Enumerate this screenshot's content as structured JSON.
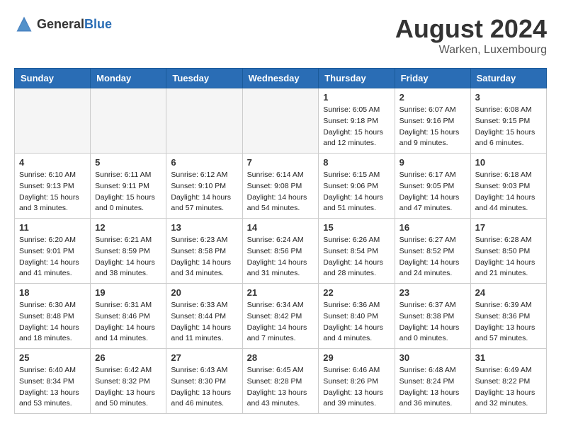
{
  "header": {
    "logo_general": "General",
    "logo_blue": "Blue",
    "month_year": "August 2024",
    "location": "Warken, Luxembourg"
  },
  "weekdays": [
    "Sunday",
    "Monday",
    "Tuesday",
    "Wednesday",
    "Thursday",
    "Friday",
    "Saturday"
  ],
  "weeks": [
    [
      {
        "day": "",
        "info": ""
      },
      {
        "day": "",
        "info": ""
      },
      {
        "day": "",
        "info": ""
      },
      {
        "day": "",
        "info": ""
      },
      {
        "day": "1",
        "info": "Sunrise: 6:05 AM\nSunset: 9:18 PM\nDaylight: 15 hours\nand 12 minutes."
      },
      {
        "day": "2",
        "info": "Sunrise: 6:07 AM\nSunset: 9:16 PM\nDaylight: 15 hours\nand 9 minutes."
      },
      {
        "day": "3",
        "info": "Sunrise: 6:08 AM\nSunset: 9:15 PM\nDaylight: 15 hours\nand 6 minutes."
      }
    ],
    [
      {
        "day": "4",
        "info": "Sunrise: 6:10 AM\nSunset: 9:13 PM\nDaylight: 15 hours\nand 3 minutes."
      },
      {
        "day": "5",
        "info": "Sunrise: 6:11 AM\nSunset: 9:11 PM\nDaylight: 15 hours\nand 0 minutes."
      },
      {
        "day": "6",
        "info": "Sunrise: 6:12 AM\nSunset: 9:10 PM\nDaylight: 14 hours\nand 57 minutes."
      },
      {
        "day": "7",
        "info": "Sunrise: 6:14 AM\nSunset: 9:08 PM\nDaylight: 14 hours\nand 54 minutes."
      },
      {
        "day": "8",
        "info": "Sunrise: 6:15 AM\nSunset: 9:06 PM\nDaylight: 14 hours\nand 51 minutes."
      },
      {
        "day": "9",
        "info": "Sunrise: 6:17 AM\nSunset: 9:05 PM\nDaylight: 14 hours\nand 47 minutes."
      },
      {
        "day": "10",
        "info": "Sunrise: 6:18 AM\nSunset: 9:03 PM\nDaylight: 14 hours\nand 44 minutes."
      }
    ],
    [
      {
        "day": "11",
        "info": "Sunrise: 6:20 AM\nSunset: 9:01 PM\nDaylight: 14 hours\nand 41 minutes."
      },
      {
        "day": "12",
        "info": "Sunrise: 6:21 AM\nSunset: 8:59 PM\nDaylight: 14 hours\nand 38 minutes."
      },
      {
        "day": "13",
        "info": "Sunrise: 6:23 AM\nSunset: 8:58 PM\nDaylight: 14 hours\nand 34 minutes."
      },
      {
        "day": "14",
        "info": "Sunrise: 6:24 AM\nSunset: 8:56 PM\nDaylight: 14 hours\nand 31 minutes."
      },
      {
        "day": "15",
        "info": "Sunrise: 6:26 AM\nSunset: 8:54 PM\nDaylight: 14 hours\nand 28 minutes."
      },
      {
        "day": "16",
        "info": "Sunrise: 6:27 AM\nSunset: 8:52 PM\nDaylight: 14 hours\nand 24 minutes."
      },
      {
        "day": "17",
        "info": "Sunrise: 6:28 AM\nSunset: 8:50 PM\nDaylight: 14 hours\nand 21 minutes."
      }
    ],
    [
      {
        "day": "18",
        "info": "Sunrise: 6:30 AM\nSunset: 8:48 PM\nDaylight: 14 hours\nand 18 minutes."
      },
      {
        "day": "19",
        "info": "Sunrise: 6:31 AM\nSunset: 8:46 PM\nDaylight: 14 hours\nand 14 minutes."
      },
      {
        "day": "20",
        "info": "Sunrise: 6:33 AM\nSunset: 8:44 PM\nDaylight: 14 hours\nand 11 minutes."
      },
      {
        "day": "21",
        "info": "Sunrise: 6:34 AM\nSunset: 8:42 PM\nDaylight: 14 hours\nand 7 minutes."
      },
      {
        "day": "22",
        "info": "Sunrise: 6:36 AM\nSunset: 8:40 PM\nDaylight: 14 hours\nand 4 minutes."
      },
      {
        "day": "23",
        "info": "Sunrise: 6:37 AM\nSunset: 8:38 PM\nDaylight: 14 hours\nand 0 minutes."
      },
      {
        "day": "24",
        "info": "Sunrise: 6:39 AM\nSunset: 8:36 PM\nDaylight: 13 hours\nand 57 minutes."
      }
    ],
    [
      {
        "day": "25",
        "info": "Sunrise: 6:40 AM\nSunset: 8:34 PM\nDaylight: 13 hours\nand 53 minutes."
      },
      {
        "day": "26",
        "info": "Sunrise: 6:42 AM\nSunset: 8:32 PM\nDaylight: 13 hours\nand 50 minutes."
      },
      {
        "day": "27",
        "info": "Sunrise: 6:43 AM\nSunset: 8:30 PM\nDaylight: 13 hours\nand 46 minutes."
      },
      {
        "day": "28",
        "info": "Sunrise: 6:45 AM\nSunset: 8:28 PM\nDaylight: 13 hours\nand 43 minutes."
      },
      {
        "day": "29",
        "info": "Sunrise: 6:46 AM\nSunset: 8:26 PM\nDaylight: 13 hours\nand 39 minutes."
      },
      {
        "day": "30",
        "info": "Sunrise: 6:48 AM\nSunset: 8:24 PM\nDaylight: 13 hours\nand 36 minutes."
      },
      {
        "day": "31",
        "info": "Sunrise: 6:49 AM\nSunset: 8:22 PM\nDaylight: 13 hours\nand 32 minutes."
      }
    ]
  ]
}
